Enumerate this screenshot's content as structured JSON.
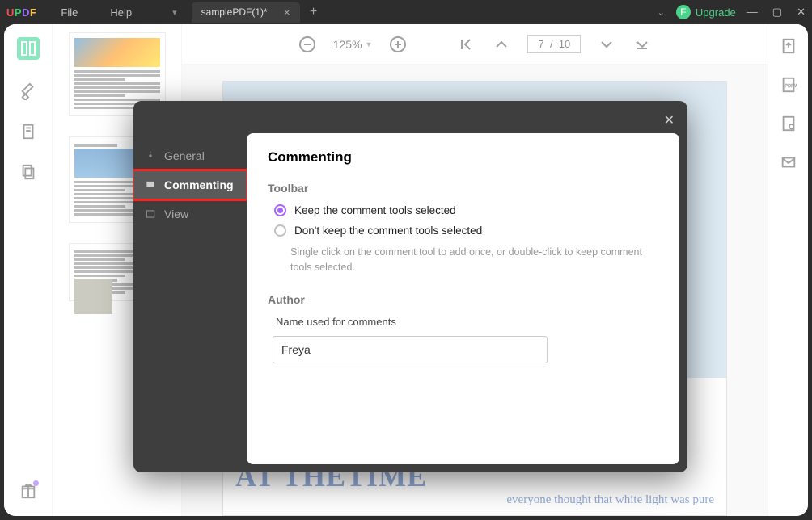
{
  "menubar": {
    "logo": {
      "u": "U",
      "p": "P",
      "d": "D",
      "f": "F"
    },
    "items": [
      "File",
      "Help"
    ],
    "tab": {
      "title": "samplePDF(1)*"
    },
    "upgrade": {
      "initial": "F",
      "label": "Upgrade"
    }
  },
  "toolbar": {
    "zoom": "125%",
    "page_current": "7",
    "page_total": "10",
    "page_sep": "/"
  },
  "document": {
    "headline": "AT THETIME",
    "subline": "everyone thought that white light was pure"
  },
  "modal": {
    "sidebar": {
      "general": "General",
      "commenting": "Commenting",
      "view": "View"
    },
    "title": "Commenting",
    "section_toolbar": "Toolbar",
    "radio_keep": "Keep the comment tools selected",
    "radio_dont": "Don't keep the comment tools selected",
    "radio_hint": "Single click on the comment tool to add once, or double-click to keep comment tools selected.",
    "section_author": "Author",
    "author_label": "Name used for comments",
    "author_value": "Freya"
  }
}
